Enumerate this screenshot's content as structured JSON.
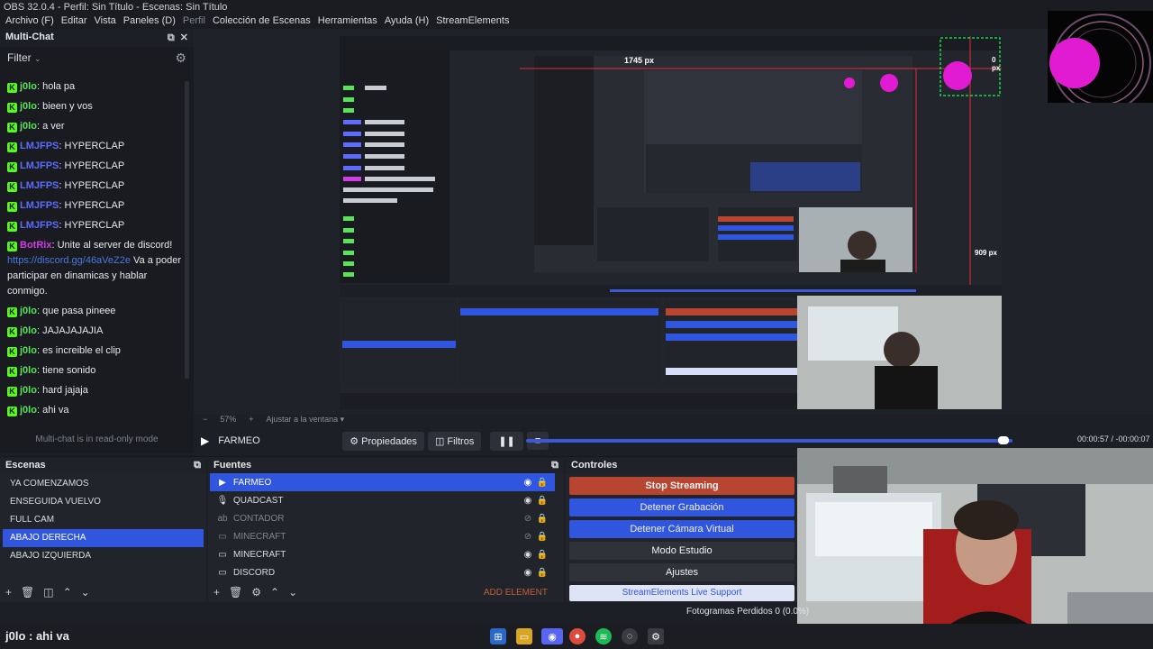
{
  "window": {
    "title": "OBS 32.0.4 - Perfil: Sin Título - Escenas: Sin Título"
  },
  "menu": {
    "items": [
      "Archivo (F)",
      "Editar",
      "Vista",
      "Paneles (D)",
      "Perfil",
      "Colección de Escenas",
      "Herramientas",
      "Ayuda (H)",
      "StreamElements"
    ]
  },
  "chat": {
    "title": "Multi-Chat",
    "filter_label": "Filter",
    "readonly_note": "Multi-chat is in read-only mode",
    "messages": [
      {
        "user": "j0lo",
        "text": "hola pa"
      },
      {
        "user": "j0lo",
        "text": "bieen y vos"
      },
      {
        "user": "j0lo",
        "text": "a ver"
      },
      {
        "user": "LMJFPS",
        "text": "HYPERCLAP"
      },
      {
        "user": "LMJFPS",
        "text": "HYPERCLAP"
      },
      {
        "user": "LMJFPS",
        "text": "HYPERCLAP"
      },
      {
        "user": "LMJFPS",
        "text": "HYPERCLAP"
      },
      {
        "user": "LMJFPS",
        "text": "HYPERCLAP"
      },
      {
        "user": "BotRix",
        "text": "Unite al server de discord!",
        "link": "https://discord.gg/46aVeZ2e",
        "more": "Va a poder participar en dinamicas y hablar conmigo."
      },
      {
        "user": "j0lo",
        "text": "que pasa pineee"
      },
      {
        "user": "j0lo",
        "text": "JAJAJAJAJIA"
      },
      {
        "user": "j0lo",
        "text": "es increible el clip"
      },
      {
        "user": "j0lo",
        "text": "tiene sonido"
      },
      {
        "user": "j0lo",
        "text": "hard jajaja"
      },
      {
        "user": "j0lo",
        "text": "ahi va"
      }
    ]
  },
  "preview": {
    "width_label": "1745 px",
    "zero_label": "0 px",
    "height_label": "909 px",
    "zoom": "57%",
    "fit_label": "Ajustar a la ventana"
  },
  "transport": {
    "source": "FARMEO",
    "properties": "Propiedades",
    "filters": "Filtros",
    "progress": 0.9,
    "time": "00:00:57 / -00:00:07"
  },
  "scenes": {
    "title": "Escenas",
    "items": [
      "YA COMENZAMOS",
      "ENSEGUIDA VUELVO",
      "FULL CAM",
      "ABAJO DERECHA",
      "ABAJO IZQUIERDA"
    ],
    "selected_index": 3
  },
  "sources": {
    "title": "Fuentes",
    "add_element": "ADD ELEMENT",
    "items": [
      {
        "name": "FARMEO",
        "icon": "play-icon",
        "visible": true,
        "selected": true
      },
      {
        "name": "QUADCAST",
        "icon": "mic-icon",
        "visible": true,
        "selected": false
      },
      {
        "name": "CONTADOR",
        "icon": "text-icon",
        "visible": false,
        "selected": false
      },
      {
        "name": "MINECRAFT",
        "icon": "window-icon",
        "visible": false,
        "selected": false
      },
      {
        "name": "MINECRAFT",
        "icon": "window-icon",
        "visible": true,
        "selected": false
      },
      {
        "name": "DISCORD",
        "icon": "window-icon",
        "visible": true,
        "selected": false
      }
    ]
  },
  "controls": {
    "title": "Controles",
    "stop_stream": "Stop Streaming",
    "stop_record": "Detener Grabación",
    "stop_vcam": "Detener Cámara Virtual",
    "studio": "Modo Estudio",
    "settings": "Ajustes",
    "live_support": "StreamElements Live Support"
  },
  "status": {
    "dropped": "Fotogramas Perdidos 0 (0.0%)"
  },
  "taskbar": {
    "message": "j0lo : ahi va"
  },
  "colors": {
    "accent": "#3056e0",
    "stop_stream": "#b8452f",
    "kick_green": "#53fc18"
  }
}
